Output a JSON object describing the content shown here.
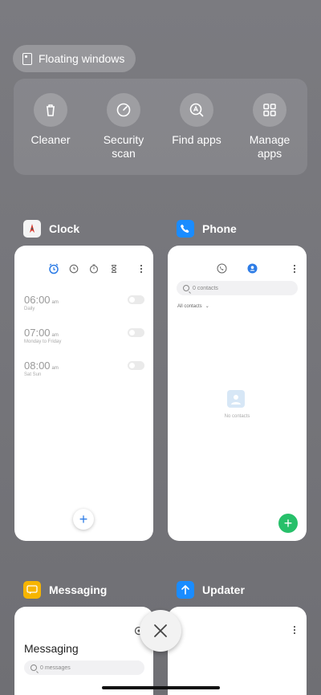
{
  "floating": {
    "label": "Floating windows"
  },
  "quick_actions": [
    {
      "label": "Cleaner",
      "icon": "trash-icon"
    },
    {
      "label": "Security scan",
      "icon": "gauge-icon"
    },
    {
      "label": "Find apps",
      "icon": "search-a-icon"
    },
    {
      "label": "Manage apps",
      "icon": "grid-icon"
    }
  ],
  "apps": {
    "clock": {
      "name": "Clock",
      "alarms": [
        {
          "time": "06:00",
          "ampm": "am",
          "repeat": "Daily"
        },
        {
          "time": "07:00",
          "ampm": "am",
          "repeat": "Monday to Friday"
        },
        {
          "time": "08:00",
          "ampm": "am",
          "repeat": "Sat Sun"
        }
      ]
    },
    "phone": {
      "name": "Phone",
      "search_placeholder": "0 contacts",
      "filter": "All contacts",
      "empty_text": "No contacts"
    },
    "messaging": {
      "name": "Messaging",
      "title": "Messaging",
      "search_placeholder": "0 messages"
    },
    "updater": {
      "name": "Updater"
    }
  },
  "colors": {
    "clock_icon_bg": "#f4f4f4",
    "phone_icon_bg": "#1a8cff",
    "messaging_icon_bg": "#f7b500",
    "updater_icon_bg": "#1a8cff",
    "fab_green": "#27c06a",
    "accent_blue": "#2d7ce6"
  }
}
